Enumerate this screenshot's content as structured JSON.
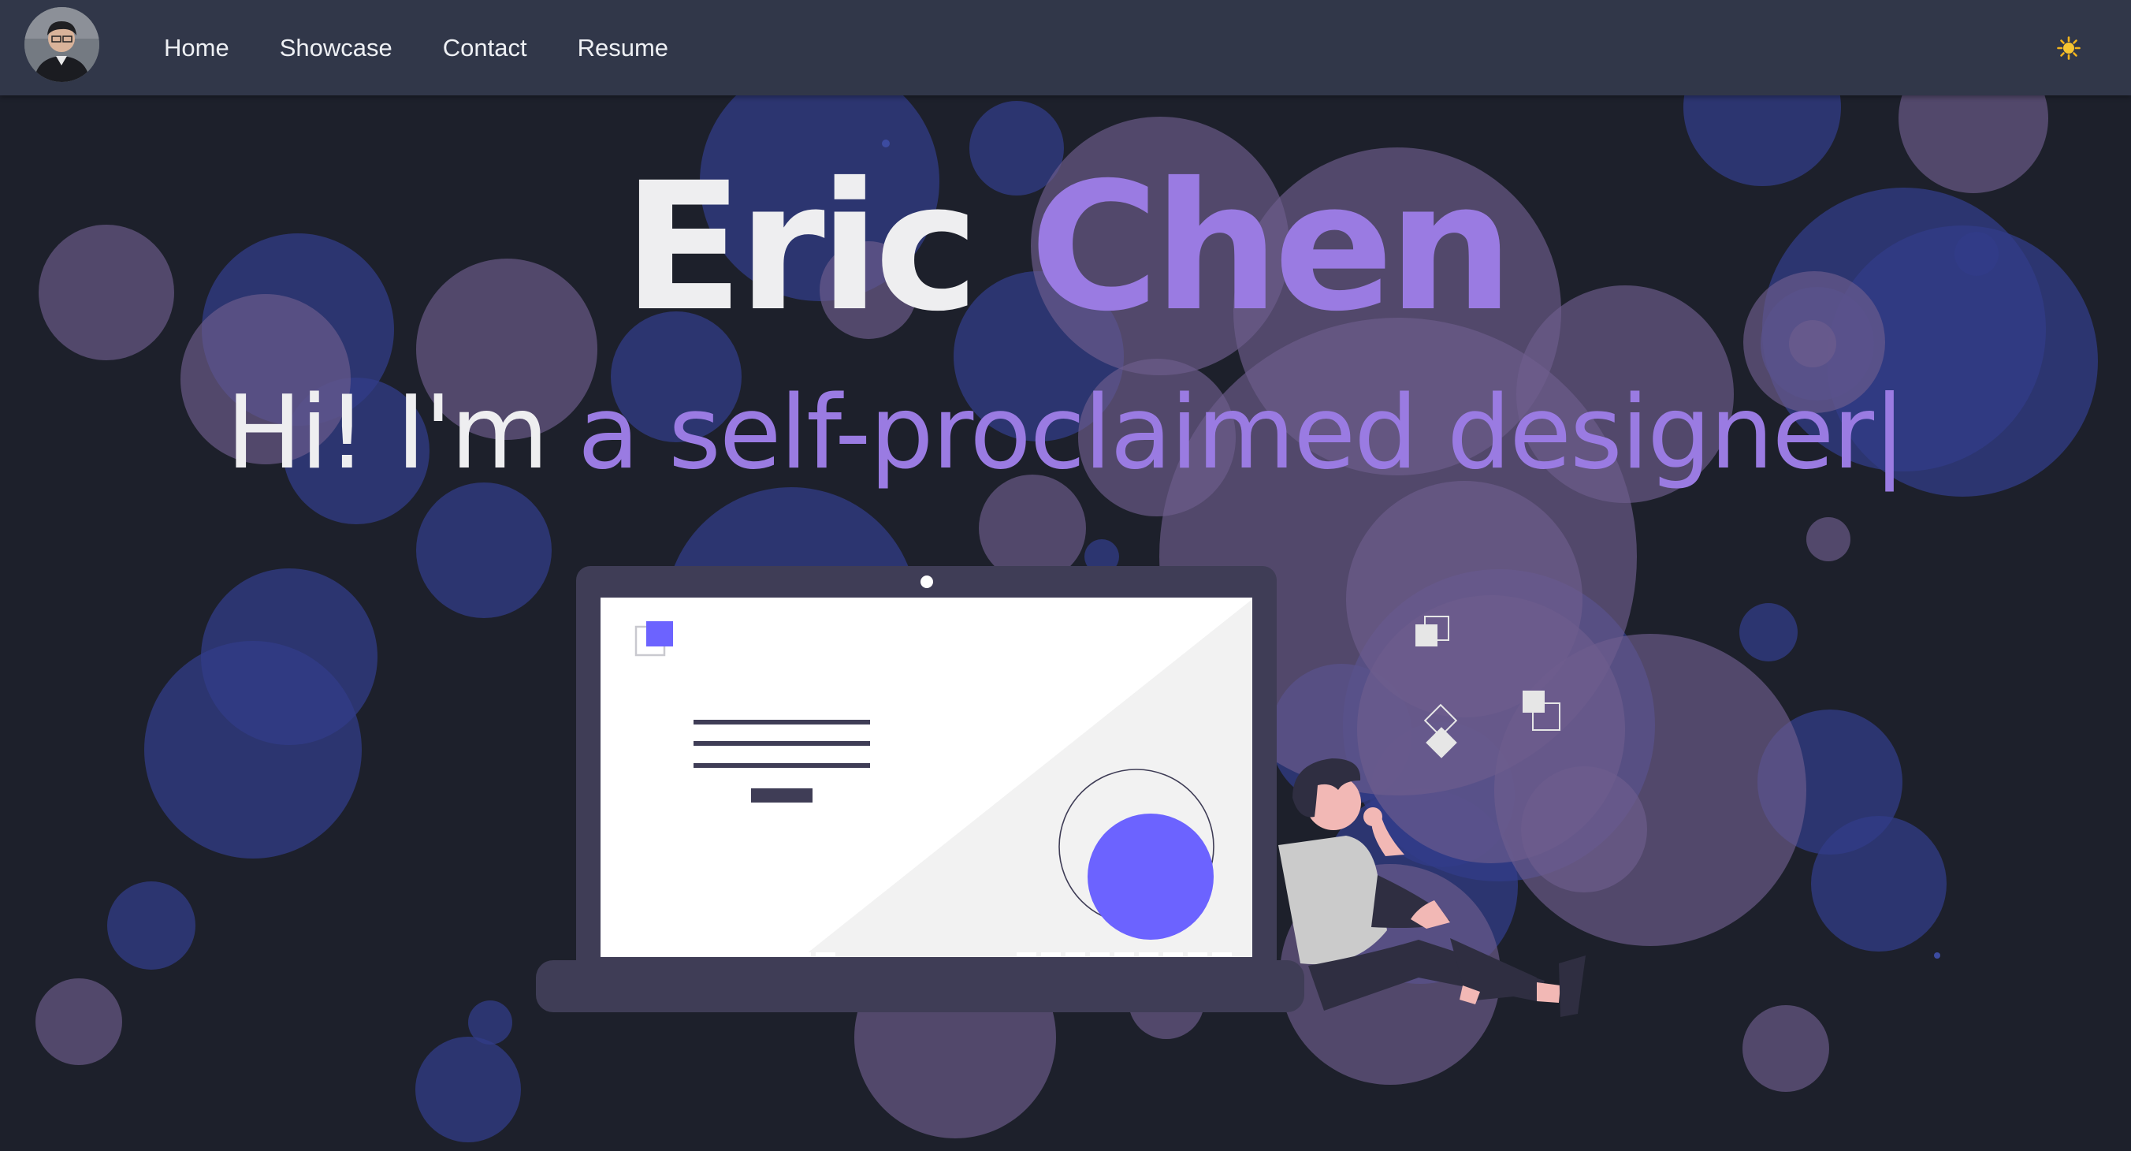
{
  "nav": {
    "links": [
      "Home",
      "Showcase",
      "Contact",
      "Resume"
    ],
    "theme_toggle_icon": "sun-icon"
  },
  "hero": {
    "first_name": "Eric",
    "last_name": "Chen",
    "greeting": "Hi! I'm",
    "role": "a self-proclaimed designer",
    "cursor": "|"
  },
  "colors": {
    "background": "#1d202b",
    "navbar": "#313749",
    "accent": "#9a7be2",
    "nav_text": "#eef0f4",
    "illustration_primary": "#6c63ff",
    "laptop_frame": "#3f3d56"
  }
}
